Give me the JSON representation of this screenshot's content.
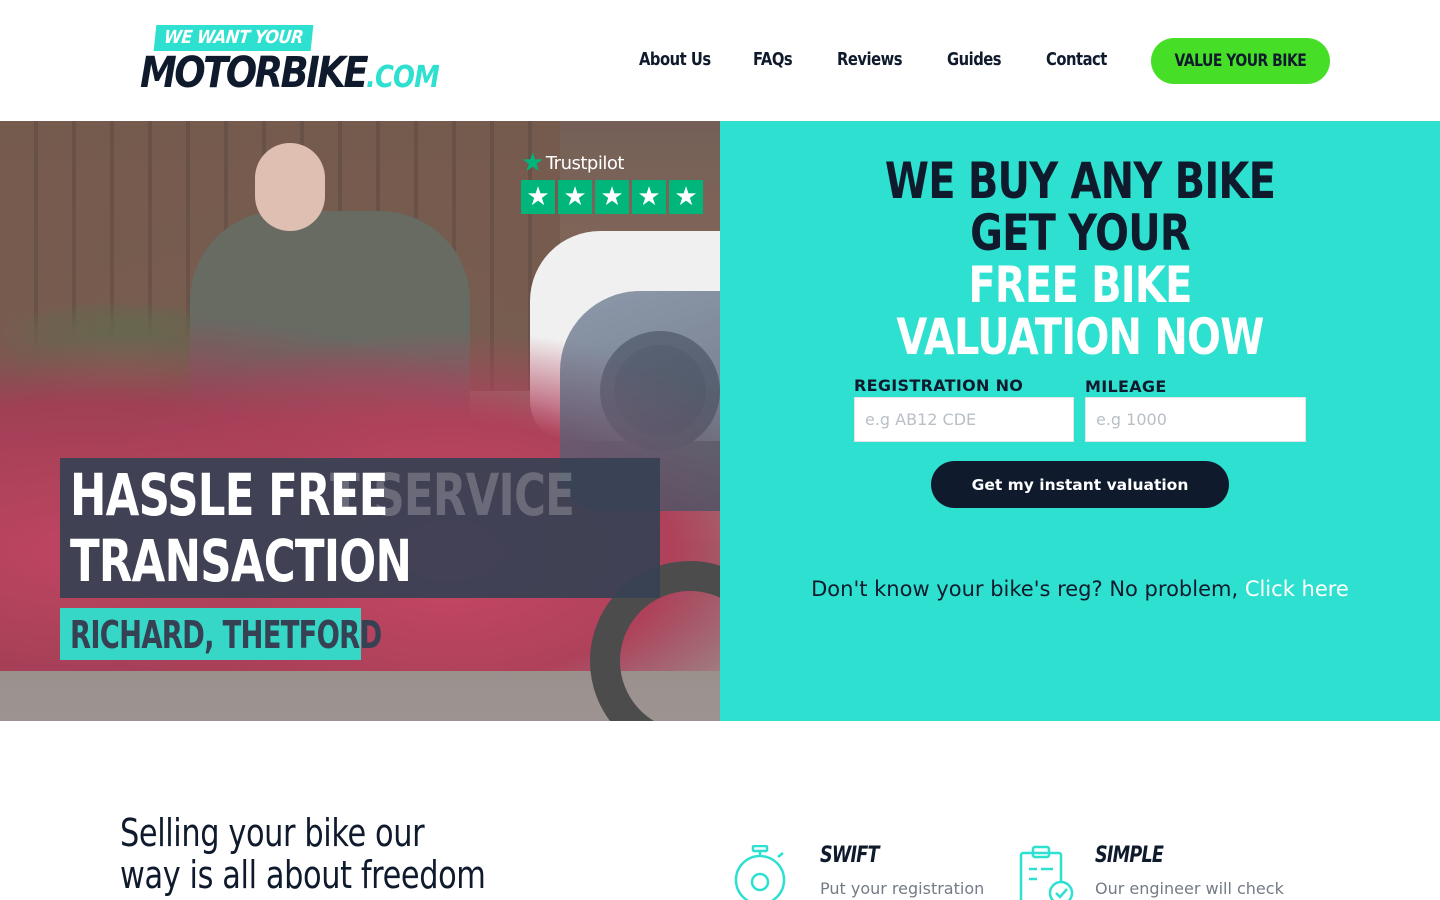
{
  "brand": {
    "tagline": "WE WANT YOUR",
    "name": "MOTORBIKE",
    "suffix": ".COM",
    "colors": {
      "accent": "#2ee0d0",
      "dark": "#0f1b2d",
      "cta": "#46de26"
    }
  },
  "nav": {
    "items": [
      {
        "label": "About Us"
      },
      {
        "label": "FAQs"
      },
      {
        "label": "Reviews"
      },
      {
        "label": "Guides"
      },
      {
        "label": "Contact"
      }
    ],
    "cta_label": "VALUE YOUR BIKE"
  },
  "hero": {
    "trustpilot": {
      "name": "Trustpilot",
      "star_icon": "star-icon",
      "stars": 5
    },
    "testimonial": {
      "line1": "HASSLE FREE",
      "line2": "TRANSACTION",
      "ghost": "T SERVICE",
      "author": "RICHARD, THETFORD"
    },
    "headline": {
      "line1": "WE BUY ANY BIKE",
      "line2": "GET YOUR",
      "line3": "FREE BIKE",
      "line4": "VALUATION NOW"
    },
    "form": {
      "reg_label": "REGISTRATION NO",
      "reg_placeholder": "e.g AB12 CDE",
      "mileage_label": "MILEAGE",
      "mileage_placeholder": "e.g 1000",
      "submit_label": "Get my instant valuation"
    },
    "reg_help": {
      "text": "Don't know your bike's reg? No problem, ",
      "link": "Click here"
    }
  },
  "section": {
    "title_line1": "Selling your bike our",
    "title_line2": "way is all about freedom",
    "features": [
      {
        "title": "SWIFT",
        "text": "Put your registration",
        "icon": "stopwatch-icon"
      },
      {
        "title": "SIMPLE",
        "text": "Our engineer will check",
        "icon": "clipboard-check-icon"
      }
    ]
  }
}
